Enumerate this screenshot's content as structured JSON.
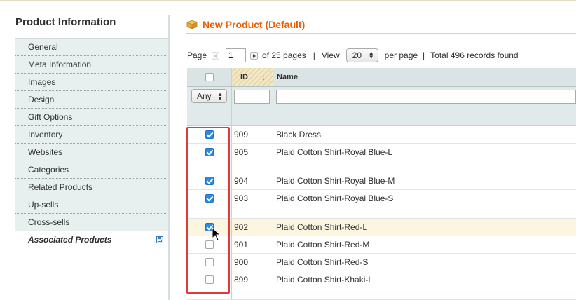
{
  "sidebar": {
    "title": "Product Information",
    "items": [
      {
        "label": "General"
      },
      {
        "label": "Meta Information"
      },
      {
        "label": "Images"
      },
      {
        "label": "Design"
      },
      {
        "label": "Gift Options"
      },
      {
        "label": "Inventory"
      },
      {
        "label": "Websites"
      },
      {
        "label": "Categories"
      },
      {
        "label": "Related Products"
      },
      {
        "label": "Up-sells"
      },
      {
        "label": "Cross-sells"
      },
      {
        "label": "Associated Products",
        "active": true
      }
    ]
  },
  "header": {
    "title": "New Product (Default)",
    "icon": "box-icon",
    "color": "#eb5e00"
  },
  "pager": {
    "page_label": "Page",
    "page_value": "1",
    "of_pages": "of 25 pages",
    "sep": "|",
    "view_label": "View",
    "per_page_value": "20",
    "per_page_label": "per page",
    "total": "Total 496 records found"
  },
  "grid": {
    "columns": {
      "id": "ID",
      "name": "Name"
    },
    "filter": {
      "any": "Any",
      "id_value": "",
      "name_value": ""
    },
    "rows": [
      {
        "checked": true,
        "id": "909",
        "name": "Black Dress",
        "height": 25
      },
      {
        "checked": true,
        "id": "905",
        "name": "Plaid Cotton Shirt-Royal Blue-L",
        "height": 41
      },
      {
        "checked": true,
        "id": "904",
        "name": "Plaid Cotton Shirt-Royal Blue-M",
        "height": 25
      },
      {
        "checked": true,
        "id": "903",
        "name": "Plaid Cotton Shirt-Royal Blue-S",
        "height": 41
      },
      {
        "checked": true,
        "id": "902",
        "name": "Plaid Cotton Shirt-Red-L",
        "height": 25,
        "highlight": true
      },
      {
        "checked": false,
        "id": "901",
        "name": "Plaid Cotton Shirt-Red-M",
        "height": 25
      },
      {
        "checked": false,
        "id": "900",
        "name": "Plaid Cotton Shirt-Red-S",
        "height": 25
      },
      {
        "checked": false,
        "id": "899",
        "name": "Plaid Cotton Shirt-Khaki-L",
        "height": 41
      }
    ]
  },
  "colors": {
    "accent": "#eb5e00",
    "sidebar_bg": "#e7efef",
    "check_blue": "#2b8ae6",
    "annotation_red": "#e03a3a"
  }
}
